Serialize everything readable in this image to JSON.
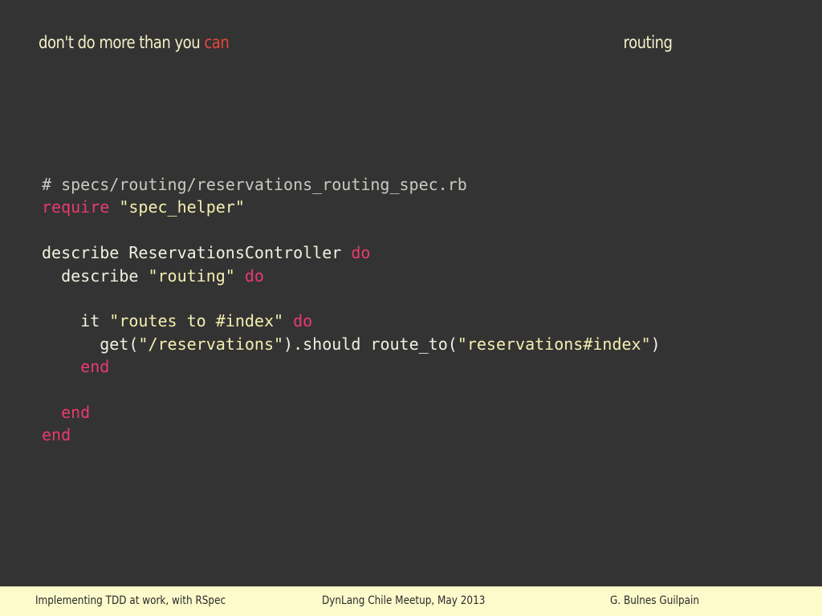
{
  "header": {
    "title_prefix": "don't do more than you",
    "title_accent": "can",
    "section": "routing"
  },
  "code": {
    "lines": [
      [
        {
          "t": "comment",
          "v": "# specs/routing/reservations_routing_spec.rb"
        }
      ],
      [
        {
          "t": "keyword",
          "v": "require"
        },
        {
          "t": "plain",
          "v": " "
        },
        {
          "t": "string",
          "v": "\"spec_helper\""
        }
      ],
      [],
      [
        {
          "t": "plain",
          "v": "describe ReservationsController "
        },
        {
          "t": "keyword",
          "v": "do"
        }
      ],
      [
        {
          "t": "plain",
          "v": "  describe "
        },
        {
          "t": "string",
          "v": "\"routing\""
        },
        {
          "t": "plain",
          "v": " "
        },
        {
          "t": "keyword",
          "v": "do"
        }
      ],
      [],
      [
        {
          "t": "plain",
          "v": "    it "
        },
        {
          "t": "string",
          "v": "\"routes to #index\""
        },
        {
          "t": "plain",
          "v": " "
        },
        {
          "t": "keyword",
          "v": "do"
        }
      ],
      [
        {
          "t": "plain",
          "v": "      get("
        },
        {
          "t": "string",
          "v": "\"/reservations\""
        },
        {
          "t": "plain",
          "v": ").should route_to("
        },
        {
          "t": "string",
          "v": "\"reservations#index\""
        },
        {
          "t": "plain",
          "v": ")"
        }
      ],
      [
        {
          "t": "plain",
          "v": "    "
        },
        {
          "t": "keyword",
          "v": "end"
        }
      ],
      [],
      [
        {
          "t": "plain",
          "v": "  "
        },
        {
          "t": "keyword",
          "v": "end"
        }
      ],
      [
        {
          "t": "keyword",
          "v": "end"
        }
      ]
    ]
  },
  "footer": {
    "left": "Implementing TDD at work, with RSpec",
    "center": "DynLang Chile Meetup, May 2013",
    "right": "G. Bulnes Guilpain"
  },
  "colors": {
    "background": "#333333",
    "accent": "#e8453c",
    "keyword": "#e83a6f",
    "string": "#f3efb0",
    "footer_bg": "#fdfbcc"
  }
}
